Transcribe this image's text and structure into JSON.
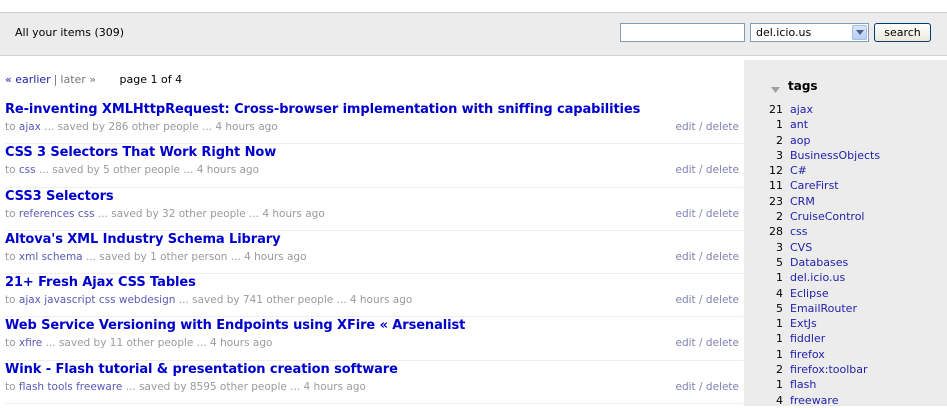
{
  "header": {
    "items_count": "All your items (309)",
    "search_placeholder": "",
    "select_value": "del.icio.us",
    "search_label": "search"
  },
  "pager": {
    "earlier": "« earlier",
    "separator": "|",
    "later": "later »",
    "page": "page 1 of 4"
  },
  "items": [
    {
      "title": "Re-inventing XMLHttpRequest: Cross-browser implementation with sniffing capabilities",
      "to": "to",
      "tags": "ajax",
      "rest": "...  saved by 286 other people  ... 4 hours ago"
    },
    {
      "title": "CSS 3 Selectors That Work Right Now",
      "to": "to",
      "tags": "css",
      "rest": "...  saved by 5 other people  ... 4 hours ago"
    },
    {
      "title": "CSS3 Selectors",
      "to": "to",
      "tags": "references css",
      "rest": "...  saved by 32 other people  ... 4 hours ago"
    },
    {
      "title": "Altova's XML Industry Schema Library",
      "to": "to",
      "tags": "xml schema",
      "rest": "...  saved by 1 other person  ... 4 hours ago"
    },
    {
      "title": "21+ Fresh Ajax CSS Tables",
      "to": "to",
      "tags": "ajax javascript css webdesign",
      "rest": "...  saved by 741 other people  ... 4 hours ago"
    },
    {
      "title": "Web Service Versioning with Endpoints using XFire « Arsenalist",
      "to": "to",
      "tags": "xfire",
      "rest": "...  saved by 11 other people  ... 4 hours ago"
    },
    {
      "title": "Wink - Flash tutorial & presentation creation software",
      "to": "to",
      "tags": "flash tools freeware",
      "rest": "...  saved by 8595 other people  ... 4 hours ago"
    }
  ],
  "actions": {
    "edit": "edit",
    "sep": "/",
    "delete": "delete"
  },
  "sidebar": {
    "heading": "tags",
    "tags": [
      {
        "count": "21",
        "name": "ajax"
      },
      {
        "count": "1",
        "name": "ant"
      },
      {
        "count": "2",
        "name": "aop"
      },
      {
        "count": "3",
        "name": "BusinessObjects"
      },
      {
        "count": "12",
        "name": "C#"
      },
      {
        "count": "11",
        "name": "CareFirst"
      },
      {
        "count": "23",
        "name": "CRM"
      },
      {
        "count": "2",
        "name": "CruiseControl"
      },
      {
        "count": "28",
        "name": "css"
      },
      {
        "count": "3",
        "name": "CVS"
      },
      {
        "count": "5",
        "name": "Databases"
      },
      {
        "count": "1",
        "name": "del.icio.us"
      },
      {
        "count": "4",
        "name": "Eclipse"
      },
      {
        "count": "5",
        "name": "EmailRouter"
      },
      {
        "count": "1",
        "name": "ExtJs"
      },
      {
        "count": "1",
        "name": "fiddler"
      },
      {
        "count": "1",
        "name": "firefox"
      },
      {
        "count": "2",
        "name": "firefox:toolbar"
      },
      {
        "count": "1",
        "name": "flash"
      },
      {
        "count": "4",
        "name": "freeware"
      }
    ]
  },
  "colors": {
    "title_link": "#0000cc",
    "tag_link": "#2222aa",
    "meta_text": "#9a9a9a",
    "panel_bg": "#ececec"
  }
}
